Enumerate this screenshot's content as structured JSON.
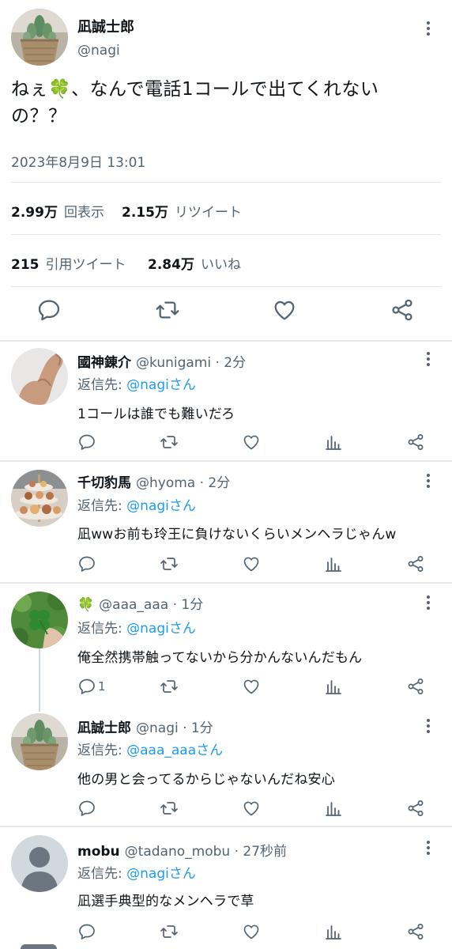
{
  "main_tweet": {
    "name": "凪誠士郎",
    "handle": "@nagi",
    "text_line1": "ねぇ🍀、なんで電話1コールで出てくれない",
    "text_line2": "の？？",
    "date": "2023年8月9日 13:01",
    "views_count": "2.99万",
    "views_label": "回表示",
    "retweets_count": "2.15万",
    "retweets_label": "リツイート",
    "quotes_count": "215",
    "quotes_label": "引用ツイート",
    "likes_count": "2.84万",
    "likes_label": "いいね"
  },
  "replies": [
    {
      "name": "國神錬介",
      "handle": "@kunigami",
      "time": "· 2分",
      "reply_prefix": "返信先:",
      "reply_to": "@nagiさん",
      "text": "1コールは誰でも難いだろ",
      "reply_count": ""
    },
    {
      "name": "千切豹馬",
      "handle": "@hyoma",
      "time": "· 2分",
      "reply_prefix": "返信先:",
      "reply_to": "@nagiさん",
      "text": "凪wwお前も玲王に負けないくらいメンヘラじゃんw",
      "reply_count": ""
    },
    {
      "name": "🍀",
      "handle": "@aaa_aaa",
      "time": "· 1分",
      "reply_prefix": "返信先:",
      "reply_to": "@nagiさん",
      "text": "俺全然携帯触ってないから分かんないんだもん",
      "reply_count": "1"
    },
    {
      "name": "凪誠士郎",
      "handle": "@nagi",
      "time": "· 1分",
      "reply_prefix": "返信先:",
      "reply_to": "@aaa_aaaさん",
      "text": "他の男と会ってるからじゃないんだね安心",
      "reply_count": ""
    },
    {
      "name": "mobu",
      "handle": "@tadano_mobu",
      "time": "· 27秒前",
      "reply_prefix": "返信先:",
      "reply_to": "@nagiさん",
      "text": "凪選手典型的なメンヘラで草",
      "reply_count": ""
    }
  ],
  "icons": [
    "reply-icon",
    "retweet-icon",
    "like-icon",
    "share-icon",
    "analytics-icon",
    "more-icon"
  ],
  "colors": {
    "link": "#1d9bf0",
    "secondary_text": "#536471",
    "primary_text": "#0f1419",
    "divider": "#e4e7ea"
  }
}
